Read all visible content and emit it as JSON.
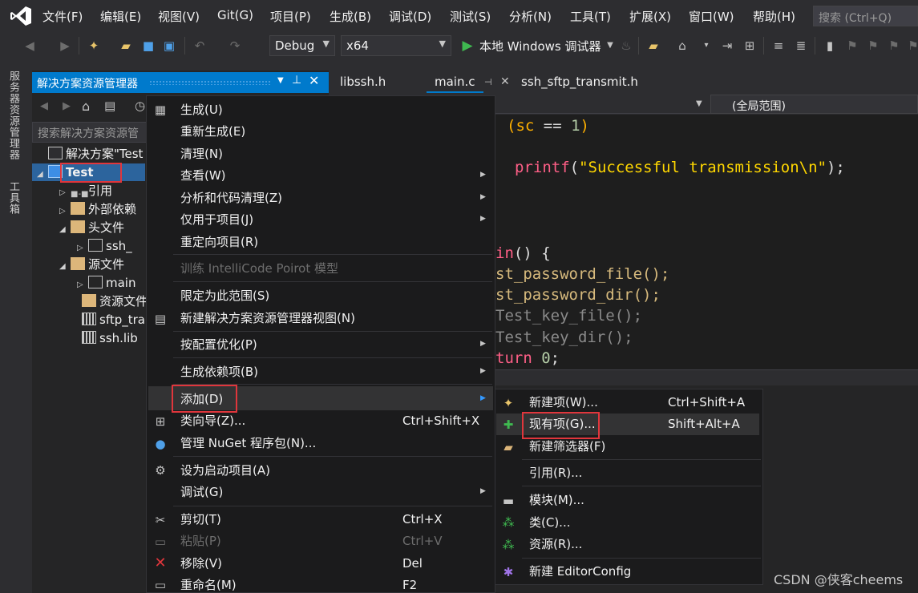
{
  "menubar": {
    "items": [
      "文件(F)",
      "编辑(E)",
      "视图(V)",
      "Git(G)",
      "项目(P)",
      "生成(B)",
      "调试(D)",
      "测试(S)",
      "分析(N)",
      "工具(T)",
      "扩展(X)",
      "窗口(W)",
      "帮助(H)"
    ],
    "search_placeholder": "搜索 (Ctrl+Q)"
  },
  "toolbar": {
    "config": "Debug",
    "platform": "x64",
    "run_label": "本地 Windows 调试器"
  },
  "left_strip": {
    "tab1": "服务器资源管理器",
    "tab2": "工具箱"
  },
  "solution_explorer": {
    "title": "解决方案资源管理器",
    "search_placeholder": "搜索解决方案资源管",
    "tree": [
      {
        "label": "解决方案\"Test"
      },
      {
        "label": "Test"
      },
      {
        "label": "引用"
      },
      {
        "label": "外部依赖"
      },
      {
        "label": "头文件"
      },
      {
        "label": "ssh_"
      },
      {
        "label": "源文件"
      },
      {
        "label": "main"
      },
      {
        "label": "资源文件"
      },
      {
        "label": "sftp_tra"
      },
      {
        "label": "ssh.lib"
      }
    ]
  },
  "editor": {
    "tabs": [
      "libssh.h",
      "main.c",
      "ssh_sftp_transmit.h"
    ],
    "active_tab": "main.c",
    "scope": "(全局范围)",
    "code_lines": {
      "l1_kw": "(sc",
      "l1_op": " == ",
      "l1_num": "1",
      "l1_end": ")",
      "l2_fn": "printf",
      "l2_open": "(",
      "l2_str": "\"Successful transmission\\n\"",
      "l2_end": ");",
      "l3_fn": "in",
      "l3_end": "() {",
      "l4": "st_password_file();",
      "l5": "st_password_dir();",
      "l6": "Test_key_file();",
      "l7": "Test_key_dir();",
      "l8_kw": "turn ",
      "l8_num": "0",
      "l8_end": ";"
    }
  },
  "context_menu": {
    "items": {
      "build": "生成(U)",
      "rebuild": "重新生成(E)",
      "clean": "清理(N)",
      "view": "查看(W)",
      "analyze": "分析和代码清理(Z)",
      "project_only": "仅用于项目(J)",
      "retarget": "重定向项目(R)",
      "intellicode": "训练 IntelliCode Poirot 模型",
      "scope": "限定为此范围(S)",
      "new_view": "新建解决方案资源管理器视图(N)",
      "pgo": "按配置优化(P)",
      "build_deps": "生成依赖项(B)",
      "add": "添加(D)",
      "class_wizard": "类向导(Z)...",
      "nuget": "管理 NuGet 程序包(N)...",
      "startup": "设为启动项目(A)",
      "debug": "调试(G)",
      "cut": "剪切(T)",
      "paste": "粘贴(P)",
      "remove": "移除(V)",
      "rename": "重命名(M)"
    },
    "shortcuts": {
      "class_wizard": "Ctrl+Shift+X",
      "cut": "Ctrl+X",
      "paste": "Ctrl+V",
      "remove": "Del",
      "rename": "F2"
    }
  },
  "submenu": {
    "items": {
      "new_item": "新建项(W)...",
      "existing_item": "现有项(G)...",
      "new_filter": "新建筛选器(F)",
      "reference": "引用(R)...",
      "module": "模块(M)...",
      "class": "类(C)...",
      "resource": "资源(R)...",
      "editorconfig": "新建 EditorConfig"
    },
    "shortcuts": {
      "new_item": "Ctrl+Shift+A",
      "existing_item": "Shift+Alt+A"
    }
  },
  "watermark": "CSDN @侠客cheems",
  "colors": {
    "accent": "#007acc",
    "highlight_box": "#e0363c"
  }
}
